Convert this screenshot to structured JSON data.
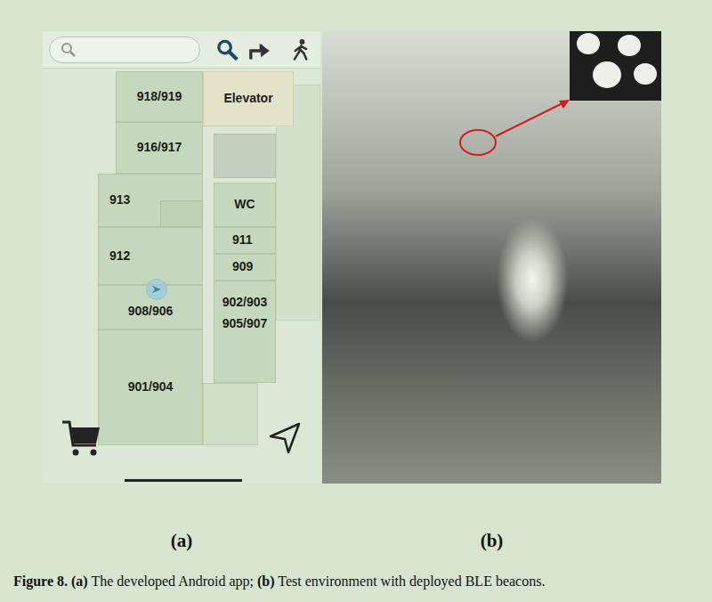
{
  "app": {
    "rooms": [
      {
        "lines": [
          "918/919"
        ]
      },
      {
        "lines": [
          "916/917"
        ]
      },
      {
        "lines": [
          "Elevator"
        ]
      },
      {
        "lines": [
          "913"
        ]
      },
      {
        "lines": [
          "WC"
        ]
      },
      {
        "lines": [
          "911"
        ]
      },
      {
        "lines": [
          "912"
        ]
      },
      {
        "lines": [
          "909"
        ]
      },
      {
        "lines": [
          "908/906"
        ]
      },
      {
        "lines": [
          "902/903",
          "905/907"
        ]
      },
      {
        "lines": [
          "901/904"
        ]
      }
    ]
  },
  "figure": {
    "panel_labels": [
      "(a)",
      "(b)"
    ],
    "caption": [
      {
        "text": "Figure 8.",
        "bold": true
      },
      {
        "text": " ",
        "bold": false
      },
      {
        "text": "(a)",
        "bold": true
      },
      {
        "text": " The developed Android app; ",
        "bold": false
      },
      {
        "text": "(b)",
        "bold": true
      },
      {
        "text": " Test environment with deployed BLE beacons.",
        "bold": false
      }
    ]
  }
}
